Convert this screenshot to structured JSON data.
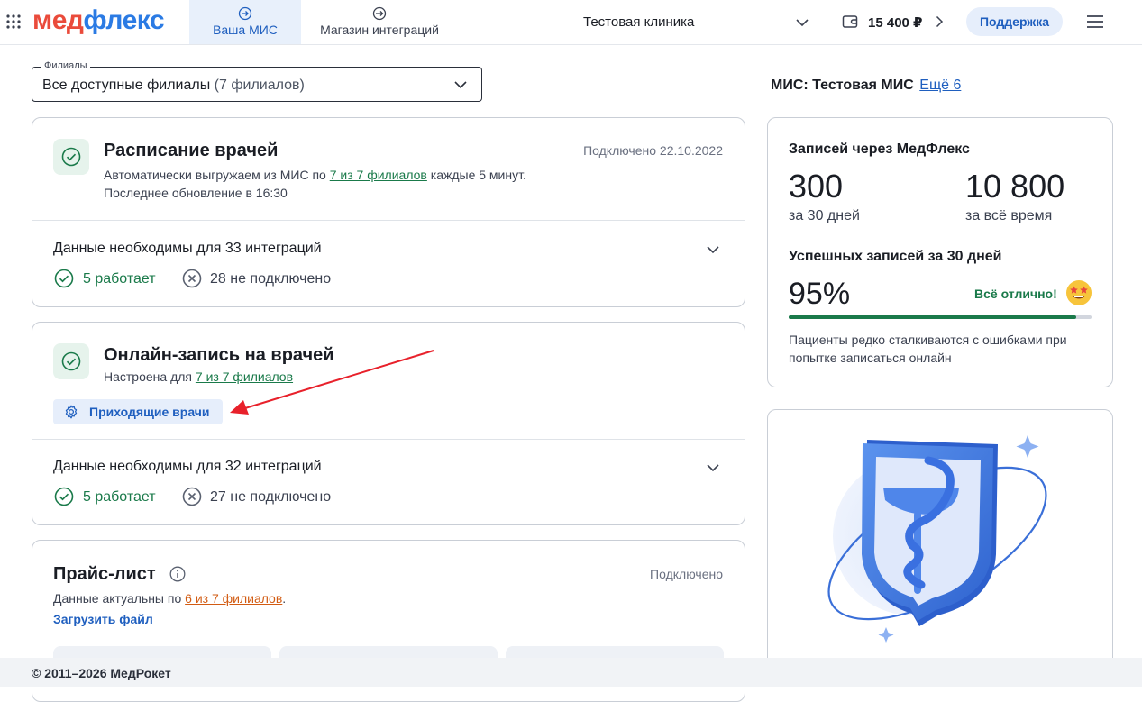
{
  "header": {
    "logo_part1": "мед",
    "logo_part2": "флекс",
    "tabs": [
      {
        "label": "Ваша МИС",
        "icon": "login-icon",
        "active": true
      },
      {
        "label": "Магазин интеграций",
        "icon": "logout-icon",
        "active": false
      }
    ],
    "clinic": "Тестовая клиника",
    "balance": "15 400 ₽",
    "support_label": "Поддержка"
  },
  "filter": {
    "legend": "Филиалы",
    "value": "Все доступные филиалы",
    "count": "(7 филиалов)"
  },
  "mis": {
    "label": "МИС: Тестовая МИС",
    "more": "Ещё 6"
  },
  "schedule_card": {
    "title": "Расписание врачей",
    "status": "Подключено 22.10.2022",
    "desc_prefix": "Автоматически выгружаем из МИС по",
    "desc_link": "7 из 7 филиалов",
    "desc_suffix": "каждые 5 минут.",
    "last_update": "Последнее обновление в 16:30",
    "needed": "Данные необходимы для 33 интеграций",
    "working": "5 работает",
    "not_connected": "28 не подключено"
  },
  "booking_card": {
    "title": "Онлайн-запись на врачей",
    "desc_prefix": "Настроена для",
    "desc_link": "7 из 7 филиалов",
    "button": "Приходящие врачи",
    "needed": "Данные необходимы для 32 интеграций",
    "working": "5 работает",
    "not_connected": "27 не подключено"
  },
  "price_card": {
    "title": "Прайс-лист",
    "status": "Подключено",
    "desc_prefix": "Данные актуальны по",
    "desc_link": "6 из 7 филиалов",
    "desc_suffix": ".",
    "upload": "Загрузить файл"
  },
  "stats_card": {
    "title": "Записей через МедФлекс",
    "v30": "300",
    "v30_label": "за 30 дней",
    "vall": "10 800",
    "vall_label": "за всё время",
    "success_title": "Успешных записей за 30 дней",
    "success_pct": "95%",
    "success_value": 0.95,
    "status": "Всё отлично!",
    "note": "Пациенты редко сталкиваются с ошибками при попытке записаться онлайн"
  },
  "footer": {
    "copyright": "© 2011–2026 МедРокет"
  },
  "colors": {
    "brand_red": "#ea4b3b",
    "brand_blue": "#2b7be4",
    "accent": "#1f5fbf",
    "success": "#1a7a4a",
    "warning_link": "#d25b12",
    "annotation_arrow": "#e8212b"
  }
}
